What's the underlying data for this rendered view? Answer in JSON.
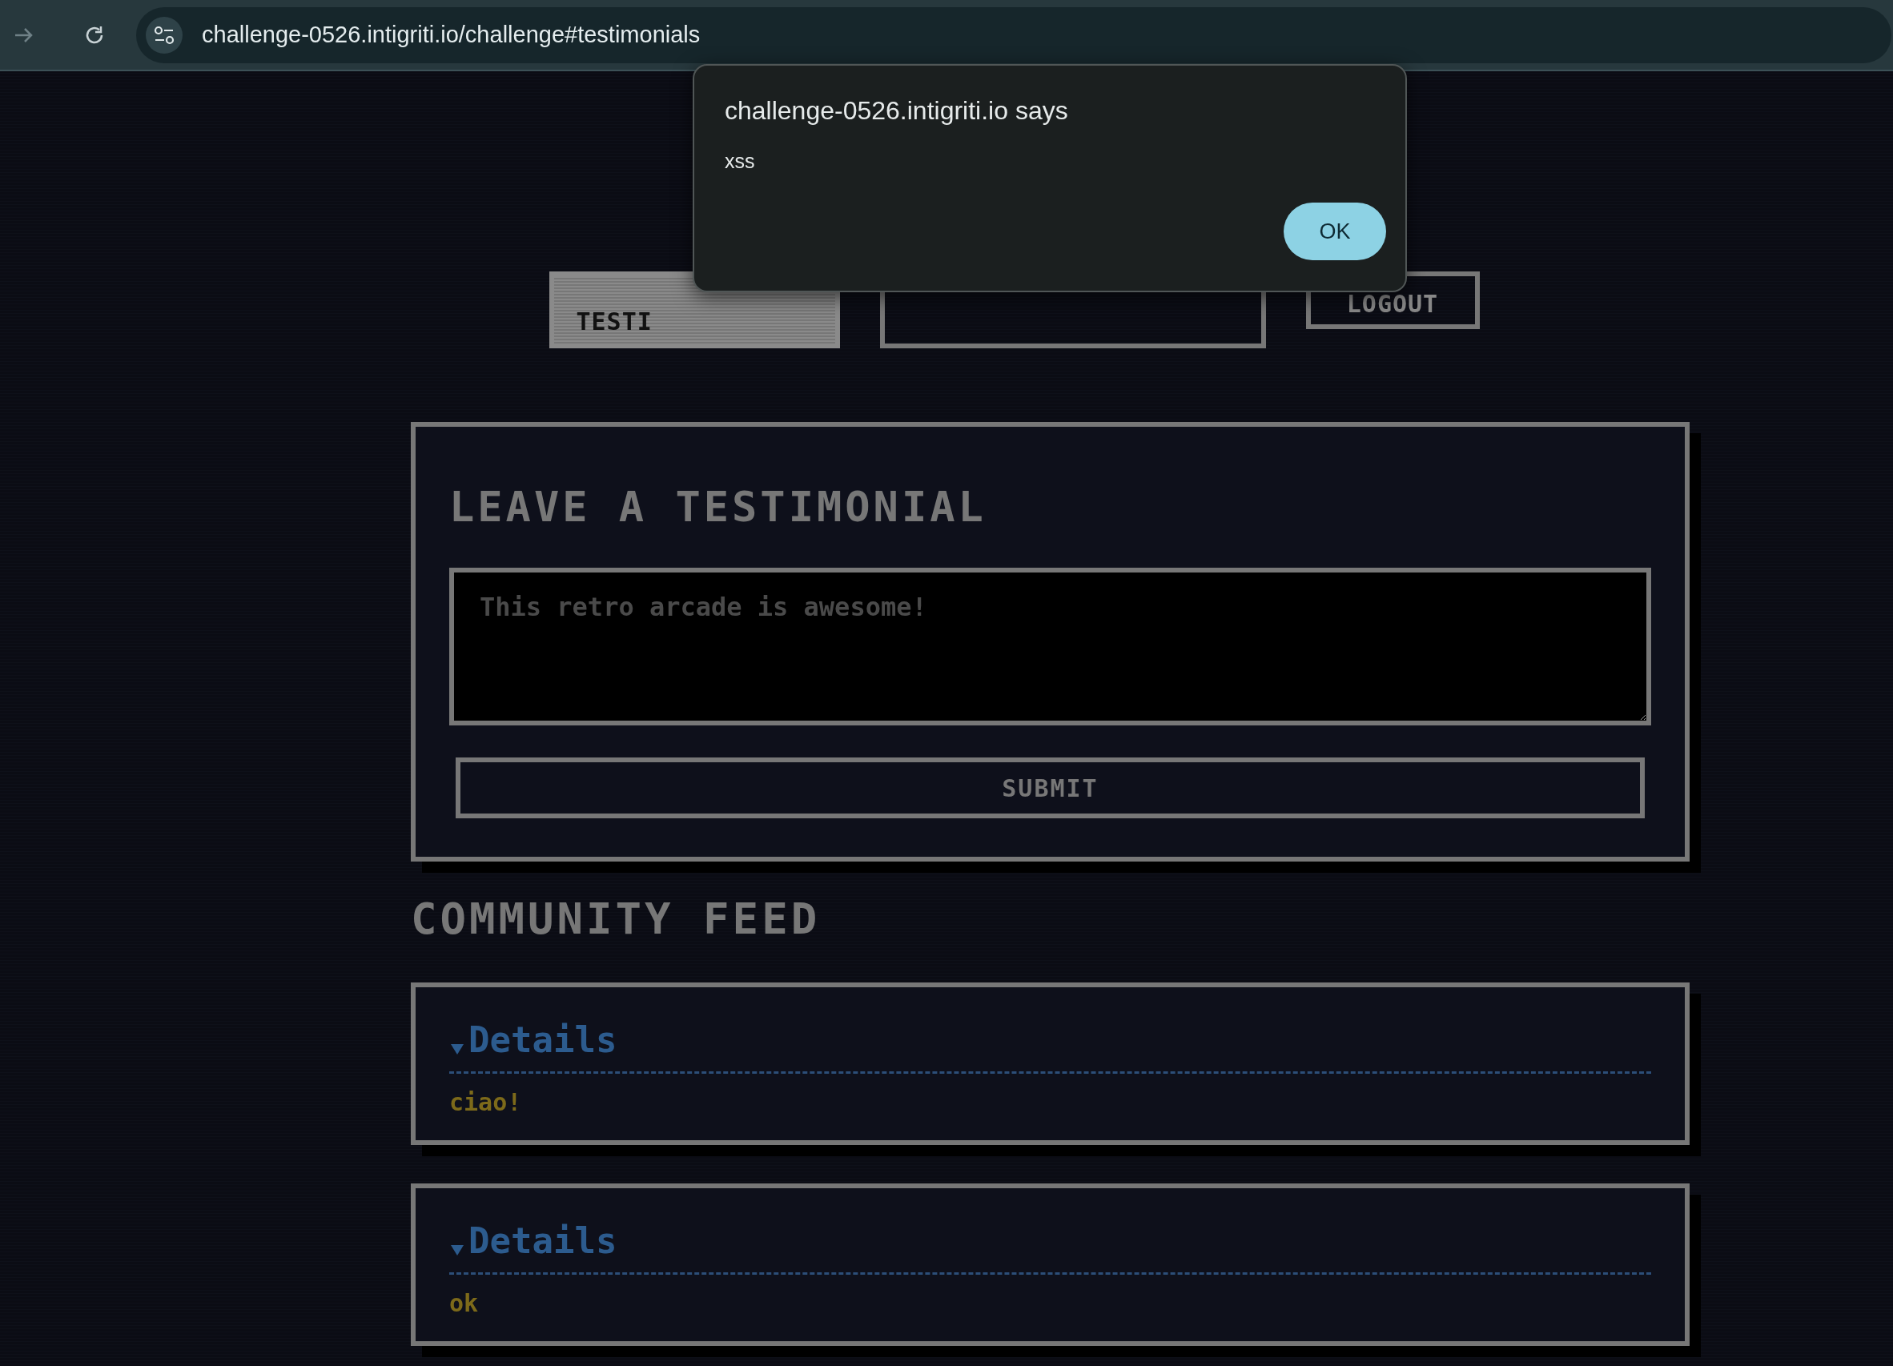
{
  "browser": {
    "url": "challenge-0526.intigriti.io/challenge#testimonials"
  },
  "alert": {
    "title": "challenge-0526.intigriti.io says",
    "message": "xss",
    "button": "OK"
  },
  "tabs": [
    {
      "label": "TESTI",
      "selected": true
    },
    {
      "selected": false
    },
    {
      "label": "LOGOUT",
      "selected": false
    }
  ],
  "form": {
    "title": "LEAVE A TESTIMONIAL",
    "placeholder": "This retro arcade is awesome!",
    "submit": "SUBMIT"
  },
  "feed": {
    "title": "COMMUNITY FEED",
    "items": [
      {
        "summary": "Details",
        "expanded": true,
        "text": "ciao!"
      },
      {
        "summary": "Details",
        "expanded": true,
        "text": "ok"
      }
    ]
  }
}
